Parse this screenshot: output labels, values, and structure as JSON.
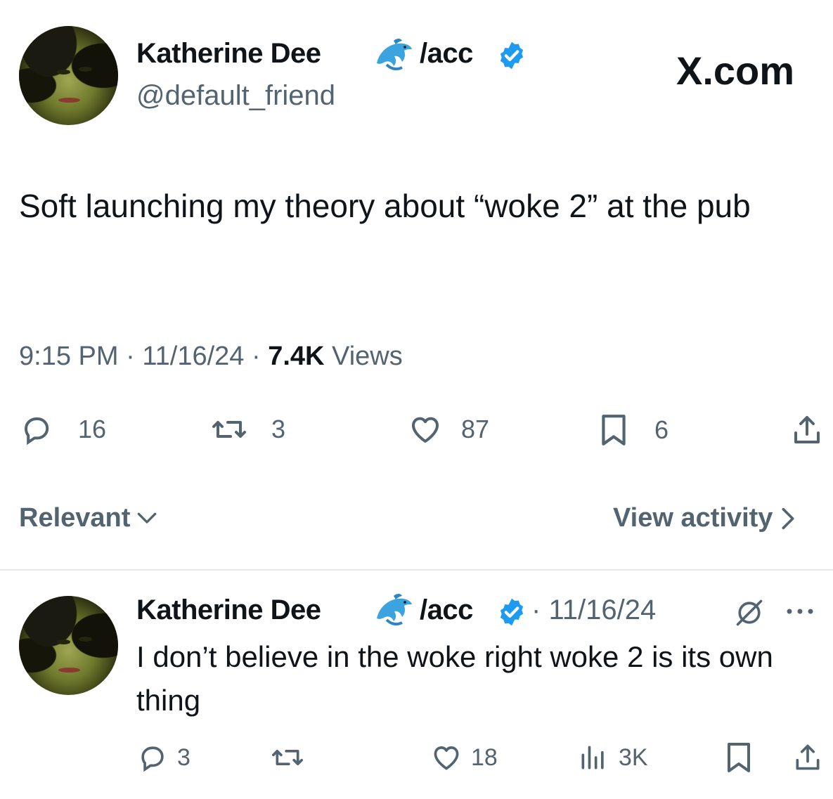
{
  "main_tweet": {
    "author_name": "Katherine Dee",
    "author_suffix": "/acc",
    "handle": "@default_friend",
    "source_logo_text": "X.com",
    "text": "Soft launching my theory about “woke 2” at the pub",
    "time": "9:15 PM",
    "sep1": "·",
    "date": "11/16/24",
    "sep2": "·",
    "views_count": "7.4K",
    "views_label": "Views",
    "replies": "16",
    "reposts": "3",
    "likes": "87",
    "bookmarks": "6"
  },
  "replies_bar": {
    "sort_label": "Relevant",
    "activity_label": "View activity"
  },
  "reply": {
    "author_name": "Katherine Dee",
    "author_suffix": "/acc",
    "sep": "·",
    "date": "11/16/24",
    "text": "I don’t believe in the woke right woke 2 is its own thing",
    "replies": "3",
    "likes": "18",
    "views": "3K"
  },
  "colors": {
    "verified": "#1d9bf0",
    "text": "#0f1419",
    "secondary": "#536471",
    "divider": "#e6e9eb"
  },
  "icons": [
    "verified-badge-icon",
    "dolphin-emoji-icon",
    "reply-icon",
    "repost-icon",
    "like-icon",
    "bookmark-icon",
    "share-icon",
    "views-icon",
    "chevron-down-icon",
    "chevron-right-icon",
    "grok-icon",
    "more-icon"
  ]
}
